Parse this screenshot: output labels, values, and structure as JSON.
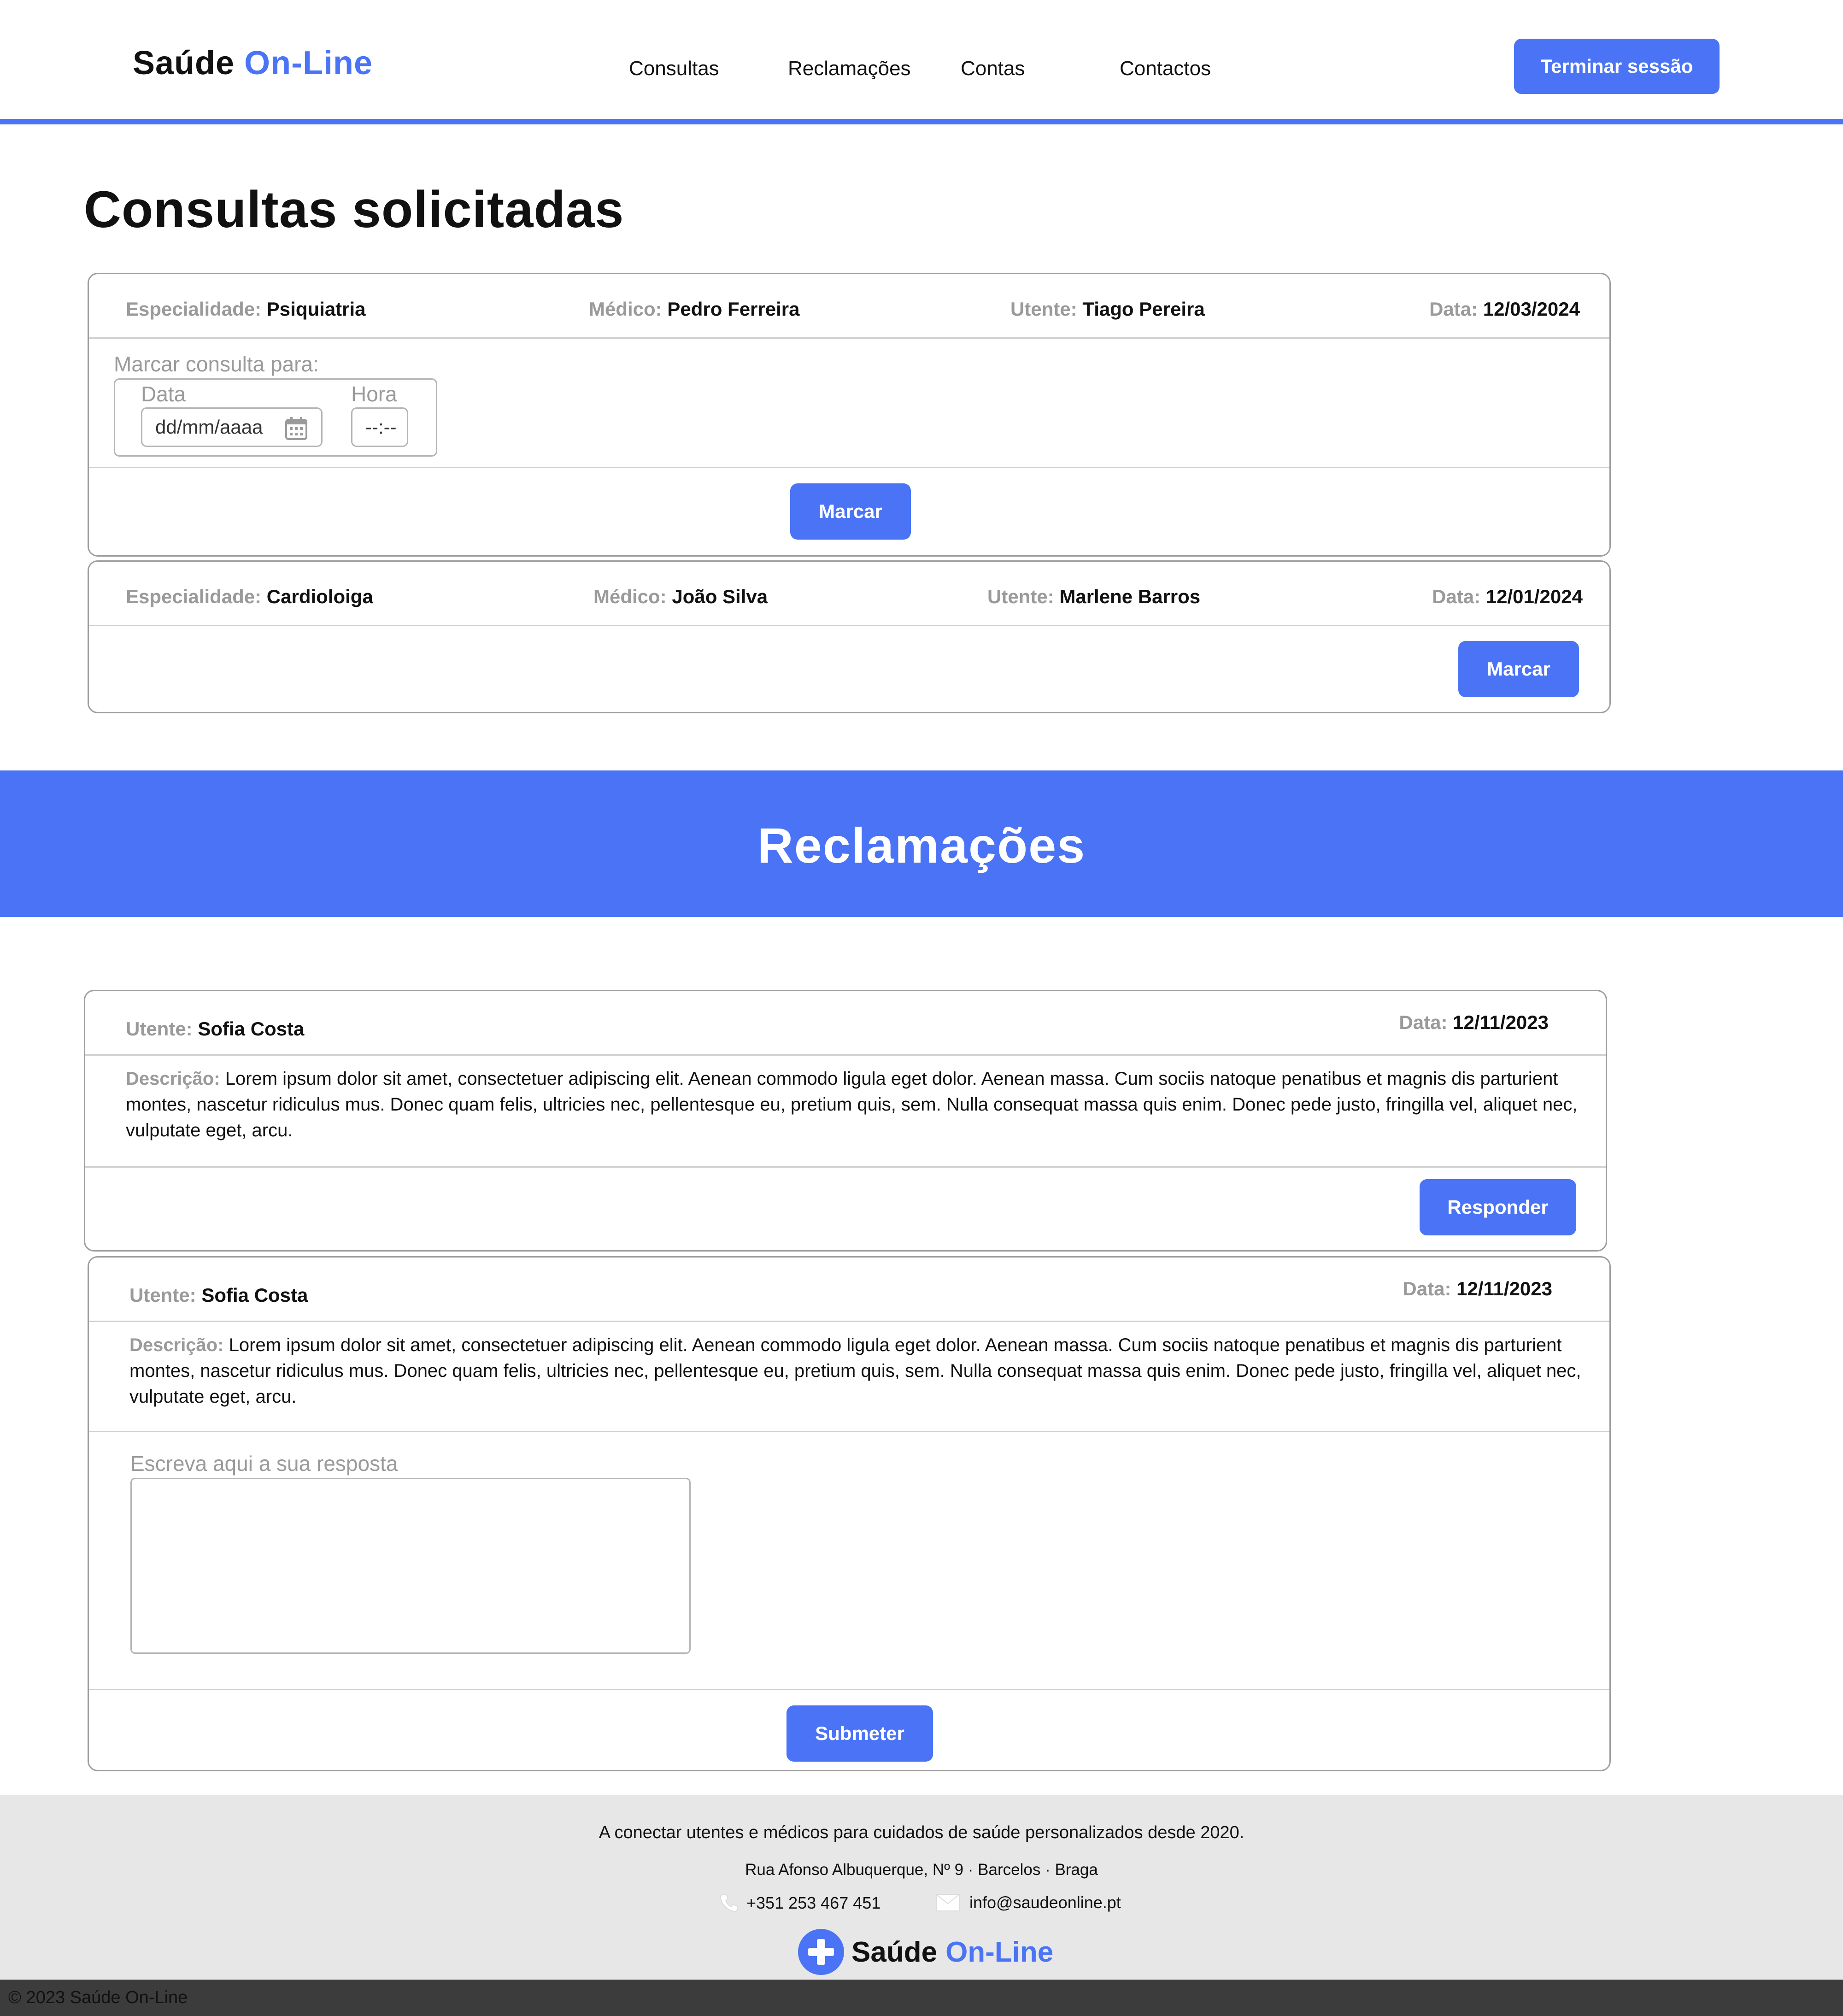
{
  "header": {
    "brand_part1": "Saúde",
    "brand_part2": "On-Line",
    "nav": [
      "Consultas",
      "Reclamações",
      "Contas",
      "Contactos"
    ],
    "logout_label": "Terminar sessão"
  },
  "consultas": {
    "title": "Consultas solicitadas",
    "labels": {
      "especialidade": "Especialidade:",
      "medico": "Médico:",
      "utente": "Utente:",
      "data": "Data:"
    },
    "items": [
      {
        "especialidade": "Psiquiatria",
        "medico": "Pedro Ferreira",
        "utente": "Tiago Pereira",
        "data": "12/03/2024"
      },
      {
        "especialidade": "Cardioloiga",
        "medico": "João Silva",
        "utente": "Marlene Barros",
        "data": "12/01/2024"
      }
    ],
    "form": {
      "caption": "Marcar consulta para:",
      "date_label": "Data",
      "date_placeholder": "dd/mm/aaaa",
      "time_label": "Hora",
      "time_placeholder": "--:--"
    },
    "button_label": "Marcar"
  },
  "reclamacoes": {
    "title": "Reclamações",
    "labels": {
      "utente": "Utente:",
      "data": "Data:",
      "descricao": "Descrição:"
    },
    "items": [
      {
        "utente": "Sofia Costa",
        "data": "12/11/2023",
        "descricao": "Lorem ipsum dolor sit amet, consectetuer adipiscing elit. Aenean commodo ligula eget dolor. Aenean massa. Cum sociis natoque penatibus et magnis dis parturient montes, nascetur ridiculus mus. Donec quam felis, ultricies nec, pellentesque eu, pretium quis, sem. Nulla consequat massa quis enim. Donec pede justo, fringilla vel, aliquet nec, vulputate eget, arcu."
      },
      {
        "utente": "Sofia Costa",
        "data": "12/11/2023",
        "descricao": "Lorem ipsum dolor sit amet, consectetuer adipiscing elit. Aenean commodo ligula eget dolor. Aenean massa. Cum sociis natoque penatibus et magnis dis parturient montes, nascetur ridiculus mus. Donec quam felis, ultricies nec, pellentesque eu, pretium quis, sem. Nulla consequat massa quis enim. Donec pede justo, fringilla vel, aliquet nec, vulputate eget, arcu."
      }
    ],
    "reply_button": "Responder",
    "reply_caption": "Escreva aqui a sua resposta",
    "submit_button": "Submeter"
  },
  "footer": {
    "tagline": "A conectar utentes e médicos para cuidados de saúde personalizados desde 2020.",
    "address": "Rua Afonso Albuquerque, Nº 9 · Barcelos · Braga",
    "phone": "+351 253 467 451",
    "email": "info@saudeonline.pt",
    "brand_part1": "Saúde",
    "brand_part2": "On-Line",
    "copyright": "© 2023 Saúde On-Line"
  },
  "colors": {
    "accent": "#4a74f5",
    "footer_bg": "#e7e7e7",
    "bottom_bar": "#3c3c3c"
  }
}
